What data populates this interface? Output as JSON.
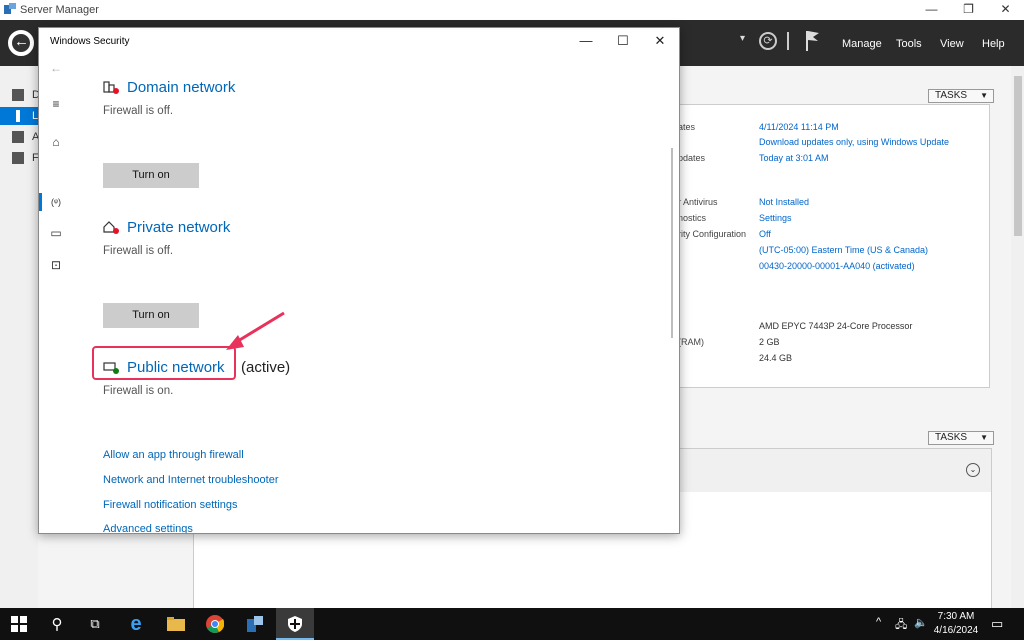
{
  "server_manager": {
    "title": "Server Manager",
    "window_buttons": [
      "—",
      "❐",
      "✕"
    ],
    "menu": [
      "Manage",
      "Tools",
      "View",
      "Help"
    ],
    "nav_letters": [
      "D",
      "L",
      "A",
      "F"
    ],
    "tasks_label": "TASKS",
    "properties": [
      {
        "label": "ates",
        "value": "4/11/2024 11:14 PM",
        "link": true
      },
      {
        "label": "",
        "value": "Download updates only, using Windows Update",
        "link": true
      },
      {
        "label": "pdates",
        "value": "Today at 3:01 AM",
        "link": true
      },
      {
        "label": "r Antivirus",
        "value": "Not Installed",
        "link": true
      },
      {
        "label": "nostics",
        "value": "Settings",
        "link": true
      },
      {
        "label": "rity Configuration",
        "value": "Off",
        "link": true
      },
      {
        "label": "",
        "value": "(UTC-05:00) Eastern Time (US & Canada)",
        "link": true
      },
      {
        "label": "",
        "value": "00430-20000-00001-AA040 (activated)",
        "link": true
      },
      {
        "label": "",
        "value": "AMD EPYC 7443P 24-Core Processor",
        "link": false
      },
      {
        "label": "(RAM)",
        "value": "2 GB",
        "link": false
      },
      {
        "label": "",
        "value": "24.4 GB",
        "link": false
      }
    ]
  },
  "windows_security": {
    "title": "Windows Security",
    "controls": [
      "—",
      "☐",
      "✕"
    ],
    "networks": [
      {
        "name": "Domain network",
        "status": "Firewall is off.",
        "button": "Turn on",
        "icon": "domain-network-icon"
      },
      {
        "name": "Private network",
        "status": "Firewall is off.",
        "button": "Turn on",
        "icon": "private-network-icon"
      },
      {
        "name": "Public network",
        "active_label": "(active)",
        "status": "Firewall is on.",
        "icon": "public-network-icon"
      }
    ],
    "links": [
      "Allow an app through firewall",
      "Network and Internet troubleshooter",
      "Firewall notification settings",
      "Advanced settings"
    ]
  },
  "taskbar": {
    "time": "7:30 AM",
    "date": "4/16/2024"
  },
  "colors": {
    "accent": "#0078d7",
    "link": "#0067b8",
    "annotation": "#e8315b"
  }
}
